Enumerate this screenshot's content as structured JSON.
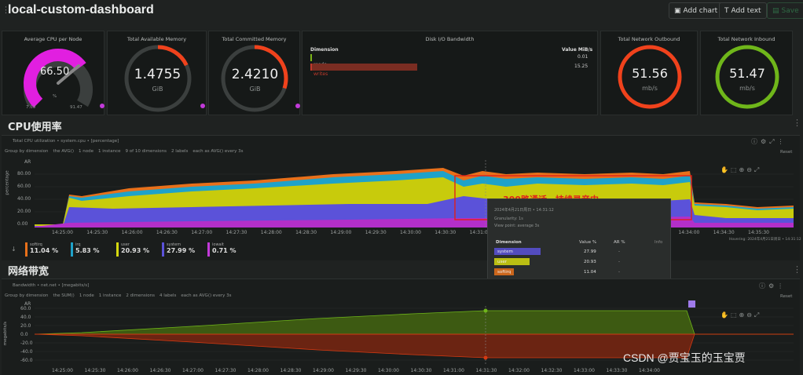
{
  "header": {
    "title": "local-custom-dashboard",
    "add_chart": "Add chart",
    "add_text": "Add text",
    "save": "Save"
  },
  "gauges": {
    "cpu": {
      "title": "Average CPU per Node",
      "value": "66.50",
      "unit": "%",
      "min": "7.69",
      "max": "91.47",
      "fill": 0.7
    },
    "mem_avail": {
      "title": "Total Available Memory",
      "value": "1.4755",
      "unit": "GiB",
      "fill": 0.18
    },
    "mem_committed": {
      "title": "Total Committed Memory",
      "value": "2.4210",
      "unit": "GiB",
      "fill": 0.3
    },
    "net_out": {
      "title": "Total Network Outbound",
      "value": "51.56",
      "unit": "mb/s",
      "fill": 1.0
    },
    "net_in": {
      "title": "Total Network Inbound",
      "value": "51.47",
      "unit": "mb/s",
      "fill": 1.0
    }
  },
  "disk": {
    "title": "Disk I/O Bandwidth",
    "dim_label": "Dimension",
    "val_label": "Value MiB/s",
    "rows": [
      {
        "name": "reads",
        "value": "0.01",
        "color": "#7cb518"
      },
      {
        "name": "writes",
        "value": "15.25",
        "color": "#c0392b"
      }
    ]
  },
  "cpu_section": {
    "title": "CPU使用率",
    "chart_title": "Total CPU utilization • system.cpu • [percentage]",
    "toolbar": [
      "Group by dimension",
      "the AVG()",
      "1 node",
      "1 instance",
      "9 of 10 dimensions",
      "2 labels",
      "each as AVG() every 3s"
    ],
    "reset": "Reset",
    "ylabel": "percentage",
    "ar": "AR",
    "yticks": [
      "80.00",
      "60.00",
      "40.00",
      "20.00",
      "0.00"
    ],
    "xticks": [
      "14:25:00",
      "14:25:30",
      "14:26:00",
      "14:26:30",
      "14:27:00",
      "14:27:30",
      "14:28:00",
      "14:28:30",
      "14:29:00",
      "14:29:30",
      "14:30:00",
      "14:30:30",
      "14:31:00",
      "14:31:30",
      "14:32:00",
      "14:32:30",
      "14:33:00",
      "14:33:30",
      "14:34:00",
      "14:34:30",
      "14:35:30"
    ],
    "annotation": "300路通话，持续录音中",
    "hover_note": "Hovering: 2024年4月21日周日 • 14:31:12",
    "chips": [
      {
        "name": "softirq",
        "value": "11.04",
        "unit": "%",
        "color": "#e8701a"
      },
      {
        "name": "irq",
        "value": "5.83",
        "unit": "%",
        "color": "#1fa2c9"
      },
      {
        "name": "user",
        "value": "20.93",
        "unit": "%",
        "color": "#d5d80f"
      },
      {
        "name": "system",
        "value": "27.99",
        "unit": "%",
        "color": "#5b52d9"
      },
      {
        "name": "iowait",
        "value": "0.71",
        "unit": "%",
        "color": "#c23ad9"
      }
    ]
  },
  "tooltip": {
    "date": "2024年4月21日周日 • 14:31:12",
    "granularity": "Granularity: 1s",
    "view_point": "View point: average 3s",
    "headers": {
      "dim": "Dimension",
      "val": "Value %",
      "ar": "AR %",
      "info": "Info"
    },
    "rows": [
      {
        "name": "system",
        "value": "27.99",
        "ar": "-",
        "color": "#5b52d9",
        "bar": 0.95
      },
      {
        "name": "user",
        "value": "20.93",
        "ar": "-",
        "color": "#d5d80f",
        "bar": 0.72
      },
      {
        "name": "softirq",
        "value": "11.04",
        "ar": "-",
        "color": "#e8701a",
        "bar": 0.38
      },
      {
        "name": "irq",
        "value": "5.83",
        "ar": "-",
        "color": "#1fa2c9",
        "bar": 0.2
      },
      {
        "name": "iowait",
        "value": "0.71",
        "ar": "-",
        "color": "#c23ad9",
        "bar": 0.03
      }
    ]
  },
  "net_section": {
    "title": "网络带宽",
    "chart_title": "Bandwidth • net.net • [megabits/s]",
    "toolbar": [
      "Group by dimension",
      "the SUM()",
      "1 node",
      "1 instance",
      "2 dimensions",
      "4 labels",
      "each as AVG() every 3s"
    ],
    "reset": "Reset",
    "ylabel": "megabits/s",
    "ar": "AR",
    "yticks": [
      "60.0",
      "40.0",
      "20.0",
      "0.0",
      "-20.0",
      "-40.0",
      "-60.0"
    ],
    "xticks": [
      "14:25:00",
      "14:25:30",
      "14:26:00",
      "14:26:30",
      "14:27:00",
      "14:27:30",
      "14:28:00",
      "14:28:30",
      "14:29:00",
      "14:29:30",
      "14:30:00",
      "14:30:30",
      "14:31:00",
      "14:31:30",
      "14:32:00",
      "14:32:30",
      "14:33:00",
      "14:33:30",
      "14:34:00"
    ]
  },
  "watermark": "CSDN @贾宝玉的玉宝贾"
}
